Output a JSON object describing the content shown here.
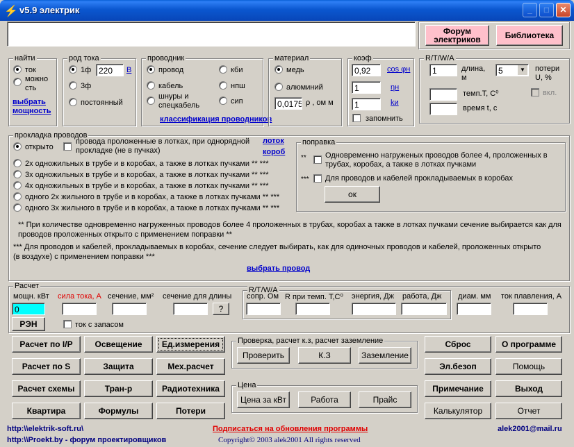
{
  "window": {
    "title": "v5.9 электрик",
    "min": "_",
    "max": "□",
    "close": "✕"
  },
  "top": {
    "forum": "Форум\nэлектриков",
    "library": "Библиотека"
  },
  "find": {
    "group": "найти",
    "tok": "ток",
    "mozhnost": "можно\nсть",
    "link": "выбрать\nмощность"
  },
  "rodtoka": {
    "group": "род тока",
    "one": "1ф",
    "three": "3ф",
    "dc": "постоянный",
    "voltage": "220",
    "unit": "В"
  },
  "conductor": {
    "group": "проводник",
    "wire": "провод",
    "kbi": "кби",
    "cable": "кабель",
    "nsh": "нпш",
    "cords": "шнуры и\nспецкабель",
    "sip": "сип",
    "link": "классификация проводников"
  },
  "material": {
    "group": "материал",
    "copper": "медь",
    "alu": "алюминий",
    "rho": "0,0175",
    "rho_unit": "ρ , ом м"
  },
  "koef": {
    "group": "коэф",
    "v1": "0,92",
    "l1": "cos φн",
    "v2": "1",
    "l2": "ηн",
    "v3": "1",
    "l3": "kи",
    "remember": "запомнить"
  },
  "rtwa": {
    "group": "R/T/W/A",
    "len": "1",
    "len_label": "длина,\nм",
    "loss_select": "5",
    "loss_label": "потери\nU, %",
    "temp_label": "темп.T, С⁰",
    "time_label": "время t, с",
    "on": "вкл."
  },
  "laying": {
    "group": "прокладка проводов",
    "open": "открыто",
    "trays": "провода проложенные в лотках, при однорядной\nпрокладке (не в пучках)",
    "link1": "лоток",
    "link2": "короб",
    "opts": [
      "2х одножильных в трубе и в коробах, а также в лотках пучками ** ***",
      "3х одножильных в трубе и в коробах, а также в лотках пучками ** ***",
      "4х одножильных в трубе и в коробах, а также в лотках пучками ** ***",
      "одного 2х жильного в трубе и в коробах, а также в лотках пучками ** ***",
      "одного 3х жильного в трубе и в коробах, а также в лотках пучками ** ***"
    ]
  },
  "correction": {
    "group": "поправка",
    "m1": "**",
    "c1": "Одновременно нагруженых проводов более 4, проложенных в\nтрубах, коробах, а также в лотках пучками",
    "m2": "***",
    "c2": "Для проводов и кабелей прокладываемых в коробах",
    "ok": "ок"
  },
  "notes": {
    "n1": "** При количестве одновременно нагруженных проводов более 4 проложенных в трубах, коробах а также в лотках пучками сечение выбирается как для\nпроводов проложенных открыто с применением поправки **",
    "n2": "*** Для проводов и кабелей, прокладываемых в коробах, сечение следует выбирать, как для одиночных проводов и кабелей, проложенных открыто\n(в воздухе) с применением поправки ***",
    "link": "выбрать провод"
  },
  "calc": {
    "group": "Расчет",
    "power": "мощн. кВт",
    "power_val": "0",
    "current": "сила тока, А",
    "section": "сечение, мм²",
    "section_len": "сечение для длины",
    "q": "?",
    "ren": "РЭН",
    "reserve": "ток с запасом",
    "rtwa": "R/T/W/A",
    "r": "сопр. Ом",
    "rt": "R при темп. T,С⁰",
    "energy": "энергия, Дж",
    "work": "работа, Дж",
    "diam": "диам. мм",
    "melt": "ток плавления, А"
  },
  "buttons": {
    "r1": [
      "Расчет по I/P",
      "Освещение",
      "Ед.измерения"
    ],
    "r2": [
      "Расчет по S",
      "Защита",
      "Мех.расчет"
    ],
    "r3": [
      "Расчет схемы",
      "Тран-р",
      "Радиотехника"
    ],
    "r4": [
      "Квартира",
      "Формулы",
      "Потери"
    ],
    "right1": [
      "Сброс",
      "О программе"
    ],
    "right2": [
      "Эл.безоп",
      "Помощь"
    ],
    "right3": [
      "Примечание",
      "Выход"
    ],
    "right4": [
      "Калькулятор",
      "Отчет"
    ]
  },
  "check": {
    "group": "Проверка, расчет к.з, расчет заземление",
    "b1": "Проверить",
    "b2": "К.З",
    "b3": "Заземление"
  },
  "price": {
    "group": "Цена",
    "b1": "Цена за кВт",
    "b2": "Работа",
    "b3": "Прайс"
  },
  "footer": {
    "url1": "http:\\\\elektrik-soft.ru\\",
    "url2": "http:\\\\Proekt.by - форум проектировщиков",
    "subscribe": "Подписаться на обновления программы",
    "copyright": "Copyright© 2003 alek2001 All rights reserved",
    "email": "alek2001@mail.ru"
  }
}
